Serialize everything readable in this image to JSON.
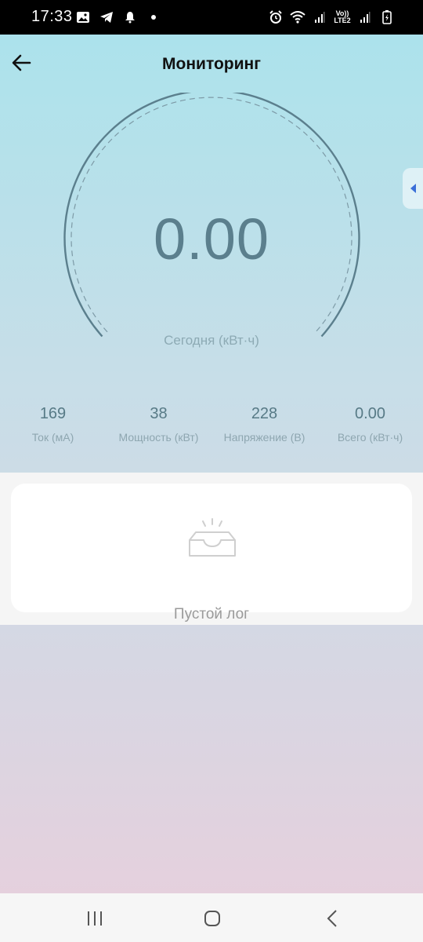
{
  "status_bar": {
    "time": "17:33",
    "left_icons": [
      "image-icon",
      "telegram-icon",
      "notification-bell-icon",
      "dot-icon"
    ],
    "right_icons": [
      "alarm-icon",
      "wifi-icon",
      "signal-icon",
      "volte-lte2-icon",
      "signal-icon",
      "battery-icon"
    ],
    "volte_top": "Vo))",
    "volte_bottom": "LTE2"
  },
  "header": {
    "title": "Мониторинг",
    "back_icon": "arrow-left-icon"
  },
  "side_tab": {
    "icon": "triangle-left-icon",
    "accent": "#3a6fd8"
  },
  "gauge": {
    "value": "0.00",
    "caption": "Сегодня (кВт·ч)",
    "arc_color": "#5b7f8d"
  },
  "stats": [
    {
      "value": "169",
      "label": "Ток (мА)"
    },
    {
      "value": "38",
      "label": "Мощность (кВт)"
    },
    {
      "value": "228",
      "label": "Напряжение (В)"
    },
    {
      "value": "0.00",
      "label": "Всего (кВт·ч)"
    }
  ],
  "log": {
    "empty_icon": "empty-inbox-icon",
    "empty_text": "Пустой лог"
  },
  "nav_bar": {
    "buttons": [
      "recent-apps-icon",
      "home-icon",
      "back-icon"
    ]
  }
}
